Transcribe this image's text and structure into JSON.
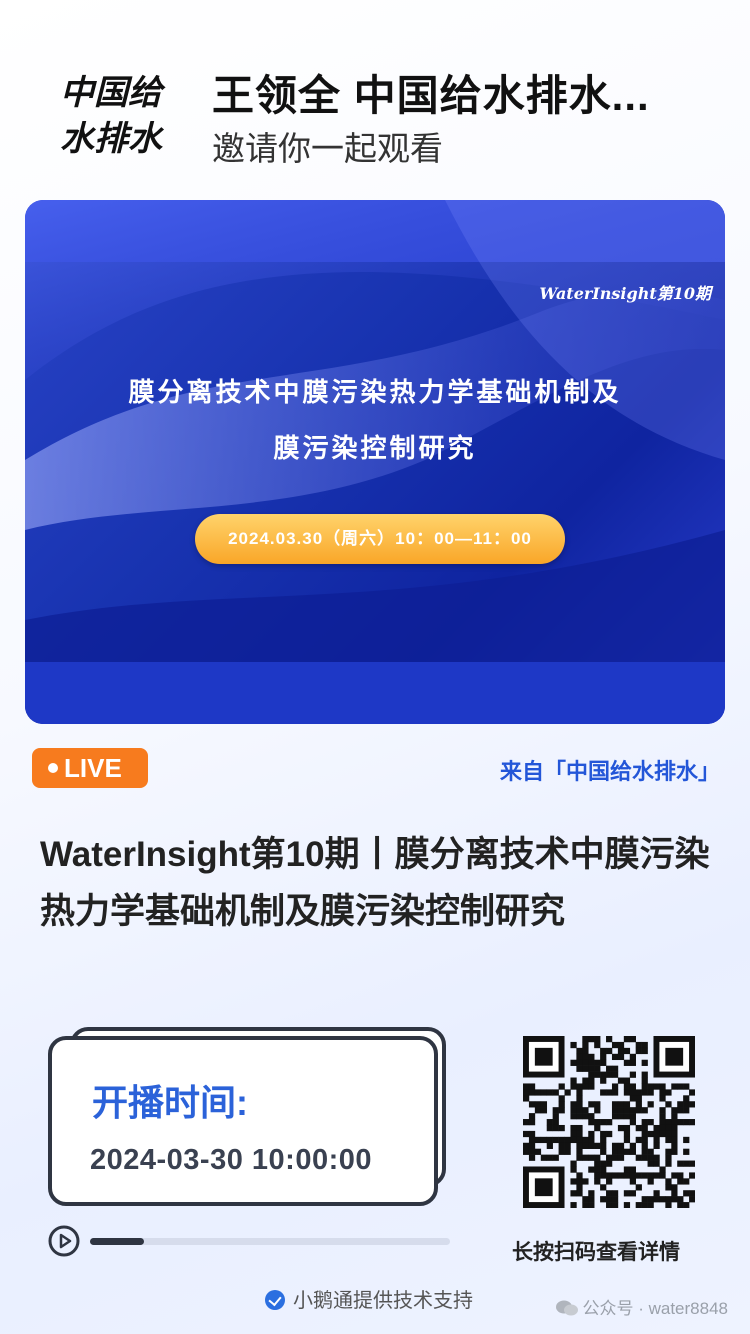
{
  "header": {
    "logo_text": "中国给水排水",
    "host_name": "王领全  中国给水排水...",
    "invite_text": "邀请你一起观看"
  },
  "banner": {
    "series_tag": "WaterInsight第10期",
    "title_line1": "膜分离技术中膜污染热力学基础机制及",
    "title_line2": "膜污染控制研究",
    "date_pill": "2024.03.30（周六）10：00—11：00"
  },
  "live": {
    "badge_label": "LIVE",
    "source_text": "来自「中国给水排水」"
  },
  "event": {
    "title": "WaterInsight第10期丨膜分离技术中膜污染热力学基础机制及膜污染控制研究"
  },
  "schedule": {
    "label": "开播时间:",
    "datetime": "2024-03-30 10:00:00",
    "progress": 0.15
  },
  "qr": {
    "caption": "长按扫码查看详情"
  },
  "footer": {
    "support_text": "小鹅通提供技术支持",
    "watermark": "公众号 · water8848"
  },
  "colors": {
    "accent_blue": "#2b62d9",
    "live_orange": "#f77b1e",
    "source_blue": "#2356d8"
  }
}
